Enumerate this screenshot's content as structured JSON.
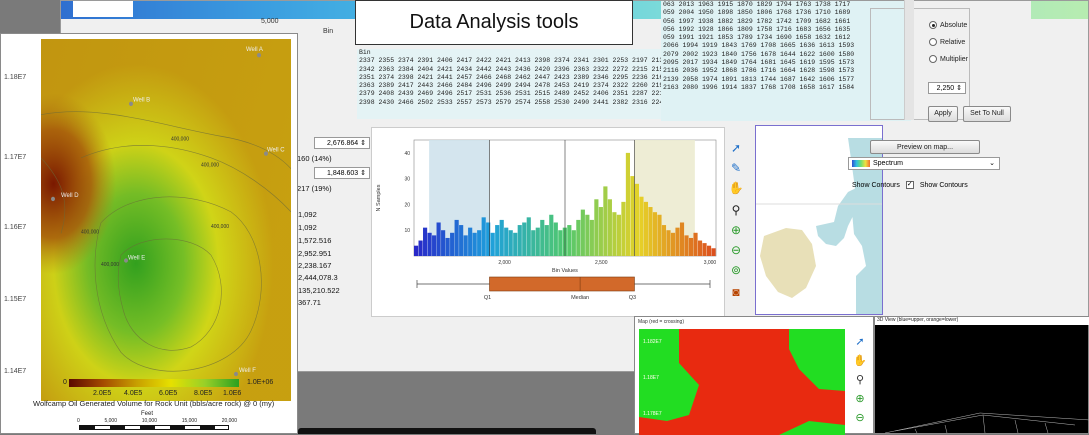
{
  "callout": {
    "text": "Data Analysis tools"
  },
  "main": {
    "scale_value": "5,000",
    "bin_label": "Bin",
    "grid_rows": [
      "063 2013 1963 1915 1870 1829 1794 1763 1738 1717",
      "059 2004 1950 1898 1850 1806 1768 1736 1710 1689",
      "056 1997 1938 1882 1829 1782 1742 1709 1682 1661",
      "056 1992 1928 1866 1809 1758 1716 1683 1656 1635",
      "059 1991 1921 1853 1789 1734 1690 1658 1632 1612",
      "2066 1994 1919 1843 1769 1708 1665 1636 1613 1593",
      "2079 2002 1923 1840 1756 1678 1644 1622 1600 1580",
      "2095 2017 1934 1849 1764 1681 1645 1619 1595 1573",
      "2116 2036 1952 1868 1786 1716 1664 1628 1598 1573",
      "2139 2058 1974 1891 1813 1744 1687 1642 1606 1577",
      "2163 2080 1996 1914 1837 1768 1708 1658 1617 1584"
    ],
    "mid_rows": [
      "2337 2355 2374 2391 2406 2417 2422 2421 2413 2398 2374 2341 2301 2253 2197 2135",
      "2342 2363 2384 2404 2421 2434 2442 2443 2436 2420 2396 2363 2322 2272 2215 2150",
      "2351 2374 2398 2421 2441 2457 2466 2468 2462 2447 2423 2389 2346 2295 2236 2169",
      "2363 2389 2417 2443 2466 2484 2496 2499 2494 2478 2453 2419 2374 2322 2260 2192",
      "2379 2408 2439 2469 2496 2517 2531 2536 2531 2515 2489 2452 2406 2351 2287 2216",
      "2398 2430 2466 2502 2533 2557 2573 2579 2574 2558 2530 2490 2441 2382 2316 2242"
    ],
    "mid_header": "Bin"
  },
  "options": {
    "radios": [
      {
        "label": "Absolute",
        "checked": true
      },
      {
        "label": "Relative",
        "checked": false
      },
      {
        "label": "Multiplier",
        "checked": false
      }
    ],
    "spin_value": "2,250",
    "apply_label": "Apply",
    "set_null_label": "Set To Null",
    "preview_label": "Preview on map...",
    "spectrum_label": "Spectrum",
    "show_contours_left": "Show Contours",
    "show_contours_right": "Show Contours"
  },
  "stats": {
    "field1": "2,676.864",
    "line1": "160 (14%)",
    "field2": "1,848.603",
    "line2": "217 (19%)",
    "values": [
      "1,092",
      "1,092",
      "1,572.516",
      "2,952.951",
      "2,238.167",
      "2,444,078.3",
      "135,210.522",
      "367.71"
    ]
  },
  "histogram": {
    "ylabel": "N Samples",
    "xlabel": "Bin Values",
    "y_ticks": [
      "40",
      "30",
      "20",
      "10"
    ],
    "x_ticks": [
      "2,000",
      "2,500",
      "3,000"
    ],
    "box_labels": [
      "Q1",
      "Median",
      "Q3"
    ]
  },
  "chart_data": {
    "type": "bar",
    "title": "",
    "xlabel": "Bin Values",
    "ylabel": "N Samples",
    "ylim": [
      0,
      45
    ],
    "values": [
      4,
      6,
      11,
      9,
      8,
      13,
      10,
      7,
      9,
      14,
      12,
      8,
      11,
      9,
      10,
      15,
      13,
      9,
      12,
      14,
      11,
      10,
      9,
      12,
      13,
      15,
      10,
      11,
      14,
      12,
      16,
      13,
      10,
      11,
      12,
      10,
      14,
      18,
      16,
      14,
      22,
      19,
      27,
      22,
      17,
      16,
      21,
      40,
      31,
      28,
      23,
      21,
      19,
      17,
      16,
      12,
      10,
      9,
      11,
      13,
      8,
      7,
      9,
      6,
      5,
      4,
      3
    ],
    "shaded_ranges": [
      [
        0.05,
        0.25
      ],
      [
        0.73,
        0.93
      ]
    ]
  },
  "map": {
    "y_labels": [
      "1.18E7",
      "1.17E7",
      "1.16E7",
      "1.15E7",
      "1.14E7"
    ],
    "wells": [
      "Well A",
      "Well B",
      "Well C",
      "Well D",
      "Well E",
      "Well F"
    ],
    "contours": [
      "400,000",
      "400,000",
      "400,000",
      "400,000",
      "400,000"
    ],
    "legend_min": "0",
    "legend_max": "1.0E+06",
    "legend_ticks": [
      "2.0E5",
      "4.0E5",
      "6.0E5",
      "8.0E5",
      "1.0E6"
    ],
    "caption": "Wolfcamp Oil Generated Volume for Rock Unit (bbls/acre rock) @ 0 (my)",
    "scale_unit": "Feet",
    "scale_ticks": [
      "0",
      "5,000",
      "10,000",
      "15,000",
      "20,000"
    ]
  },
  "cross_window": {
    "title": "Map (red = crossing)",
    "y_labels": [
      "1.182E7",
      "1.18E7",
      "1.178E7"
    ]
  },
  "view3d": {
    "title": "3D View (blue=upper, orange=lower)"
  },
  "colors": {
    "accent": "#1e6fc8",
    "map_high": "#2aa020",
    "map_low": "#5a0a00",
    "crossing": "#e82a10",
    "non_crossing": "#22dd22"
  }
}
